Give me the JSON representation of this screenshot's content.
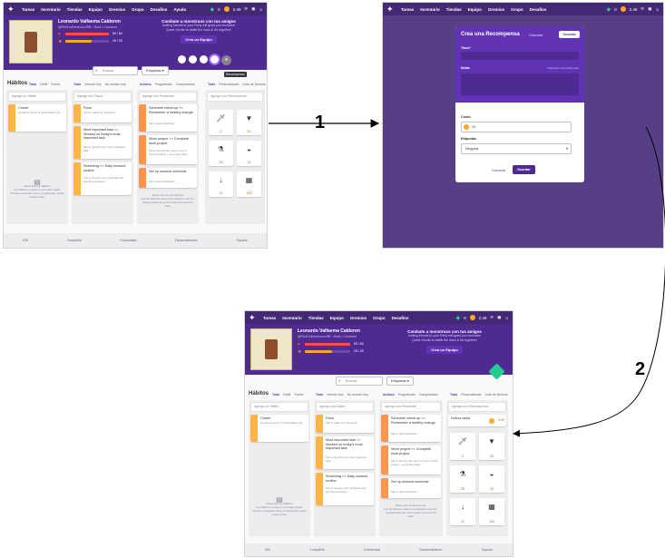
{
  "nav": {
    "links_es": [
      "Tareas",
      "Inventario",
      "Tiendas",
      "Equipo",
      "Gremios",
      "Grupo",
      "Desafíos",
      "Ayuda"
    ],
    "gems": "0",
    "gold": "2.49"
  },
  "user": {
    "name": "Leonardo Valfaema Calderon",
    "sub": "@RicH1sElectroLeoRB · Nivel 1 Guerrero",
    "hp": "50 / 50",
    "xp": "15 / 25",
    "hp_pct": 100,
    "xp_pct": 60
  },
  "party": {
    "title_es": "Combate a monstruos con tus amigos",
    "sub1_es": "Inviting friends to your Party will grant you exclusive",
    "sub2_es": "Quest Scrolls to battle the dues & it's together!",
    "button_es": "Crea un Equipo",
    "title_en": "Combate a monstruos con tus amigos",
    "button_en": "Crea un Equipo"
  },
  "toolbar": {
    "search_placeholder": "Buscar",
    "tags_label": "Etiquetas"
  },
  "habits": {
    "title": "Hábitos",
    "tabs": [
      "Todo",
      "Débil",
      "Fuerte"
    ],
    "add": "Agrega un Hábito",
    "card_title": "Comer",
    "card_notes": "sonriente comer 4 cucharadas a la …",
    "card_counter": "+0 | -0",
    "empty_title": "Estos son tus Hábitos",
    "empty_sub": "Los hábitos no tienen un horario rígido. Puedes marcarlos como completados varias veces al día."
  },
  "dailies": {
    "tabs": [
      "Todo",
      "Vencen hoy",
      "No vencen hoy"
    ],
    "add": "Agrega una Diaria",
    "cards": [
      {
        "title": "Floss",
        "notes": "Tap to make any changes!"
      },
      {
        "title": "Most important task >> Worked on today's most important task",
        "notes": "Tap to specify your most important task"
      },
      {
        "title": "Stretching >> Daily workout routine",
        "notes": "Tap to choose your schedule and specify exercises!"
      }
    ]
  },
  "todos": {
    "tabs": [
      "Activos",
      "Programado",
      "Completados"
    ],
    "add": "Agrega una Pendiente",
    "cards": [
      {
        "title": "Schedule check-up >> Remember a healthy change",
        "notes": "Tap to add checklists!"
      },
      {
        "title": "Work project >> Complete work project",
        "notes": "Tap to specify the name of your current project + set a due date!"
      },
      {
        "title": "Set up workout schedule",
        "notes": "Tap to add checklists!"
      }
    ],
    "empty_title": "Estas son tus Pendientes",
    "empty_sub": "Las Pendientes deben completarse una vez. Agrega listas de control para aumentar su valor."
  },
  "rewards": {
    "tabs": [
      "Todo",
      "Personalizado",
      "Lista de Deseos"
    ],
    "add": "Agrega una Recompensa",
    "new_reward_title": "Nueva salud",
    "new_reward_price": "0.09",
    "items": [
      {
        "icon": "sword-icon",
        "price": "0"
      },
      {
        "icon": "armor-icon",
        "price": "30"
      },
      {
        "icon": "potion-icon",
        "price": "25"
      },
      {
        "icon": "helmet-icon",
        "price": "15"
      },
      {
        "icon": "arrow-icon",
        "price": "22"
      },
      {
        "icon": "chest-icon",
        "price": "100"
      }
    ]
  },
  "footer": [
    "iOS",
    "Compañía",
    "Comunidad",
    "Desarrolladores",
    "Soporte"
  ],
  "modal": {
    "title": "Crea una Recompensa",
    "cancel": "Cancelar",
    "save": "Guardar",
    "title_label": "Título*",
    "notes_label": "Notas",
    "markdown_hint": "Markdown formatting help",
    "cost_label": "Costo",
    "cost_value": "10",
    "tags_label": "Etiquetas",
    "tags_value": "Ninguna",
    "footer_cancel": "Cancelar",
    "footer_save": "Guardar"
  },
  "annotations": {
    "step1": "1",
    "step2": "2"
  },
  "tooltip": "Recompensa"
}
